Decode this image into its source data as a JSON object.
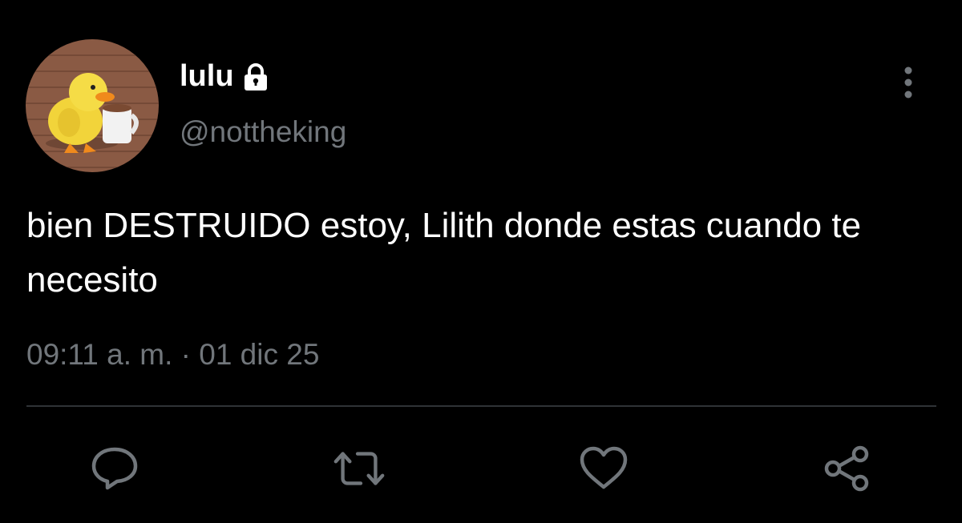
{
  "user": {
    "display_name": "lulu",
    "handle": "@nottheking",
    "protected": true,
    "avatar_icon": "duck-with-mug-avatar"
  },
  "tweet": {
    "text": "bien DESTRUIDO estoy, Lilith donde estas cuando te necesito",
    "timestamp": "09:11 a. m. · 01 dic 25"
  },
  "actions": [
    {
      "name": "reply",
      "icon": "reply-icon"
    },
    {
      "name": "retweet",
      "icon": "retweet-icon"
    },
    {
      "name": "like",
      "icon": "heart-icon"
    },
    {
      "name": "share",
      "icon": "share-icon"
    }
  ],
  "colors": {
    "background": "#000000",
    "primary_text": "#ffffff",
    "secondary_text": "#71767b",
    "divider": "#2f3336",
    "icon": "#71767b"
  }
}
